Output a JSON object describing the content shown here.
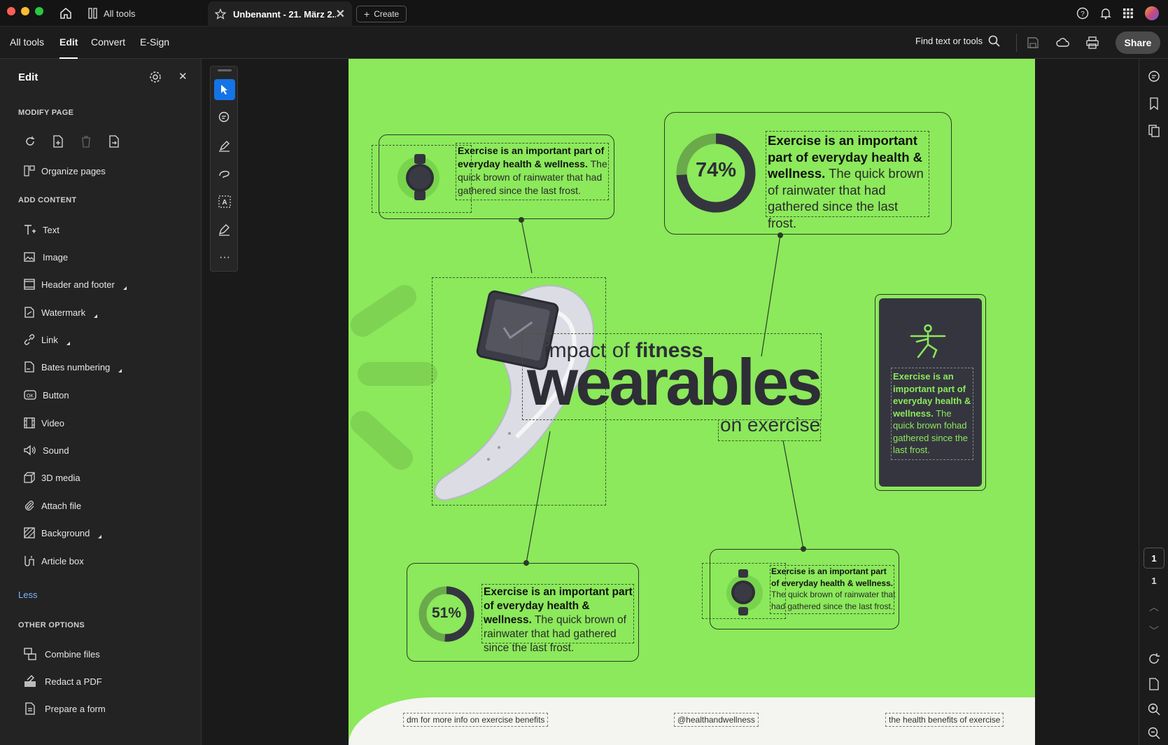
{
  "titlebar": {
    "home_tooltip": "Home",
    "all_tools": "All tools",
    "tab_title": "Unbenannt - 21. März 2...",
    "create": "Create"
  },
  "toolbar": {
    "menu": [
      "All tools",
      "Edit",
      "Convert",
      "E-Sign"
    ],
    "active": "Edit",
    "find": "Find text or tools",
    "share": "Share"
  },
  "sidebar": {
    "title": "Edit",
    "modify_page_heading": "MODIFY PAGE",
    "organize_pages": "Organize pages",
    "add_content_heading": "ADD CONTENT",
    "items": [
      {
        "label": "Text",
        "icon": "text-icon"
      },
      {
        "label": "Image",
        "icon": "image-icon"
      },
      {
        "label": "Header and footer",
        "icon": "header-footer-icon"
      },
      {
        "label": "Watermark",
        "icon": "watermark-icon"
      },
      {
        "label": "Link",
        "icon": "link-icon"
      },
      {
        "label": "Bates numbering",
        "icon": "bates-icon"
      },
      {
        "label": "Button",
        "icon": "button-icon"
      },
      {
        "label": "Video",
        "icon": "video-icon"
      },
      {
        "label": "Sound",
        "icon": "sound-icon"
      },
      {
        "label": "3D media",
        "icon": "3d-icon"
      },
      {
        "label": "Attach file",
        "icon": "attach-icon"
      },
      {
        "label": "Background",
        "icon": "background-icon"
      },
      {
        "label": "Article box",
        "icon": "article-icon"
      }
    ],
    "less": "Less",
    "other_heading": "OTHER OPTIONS",
    "other": [
      {
        "label": "Combine files",
        "icon": "combine-icon"
      },
      {
        "label": "Redact a PDF",
        "icon": "redact-icon"
      },
      {
        "label": "Prepare a form",
        "icon": "form-icon"
      }
    ]
  },
  "rightbar": {
    "page_current": "1",
    "page_total": "1"
  },
  "document": {
    "title_line1_a": "impact of ",
    "title_line1_b": "fitness",
    "title_main": "wearables",
    "title_line3": "on exercise",
    "card_bold": "Exercise is an important part of everyday health & wellness.",
    "card_rest": " The quick brown of rainwater that had gathered since the last frost.",
    "dark_card_bold": "Exercise is an important part of everyday health & wellness.",
    "dark_card_rest": " The quick brown fohad gathered since the last frost.",
    "pct_top": "74%",
    "pct_bottom": "51%",
    "footer_left": "dm for more info on exercise benefits",
    "footer_mid": "@healthandwellness",
    "footer_right": "the health benefits of exercise"
  }
}
